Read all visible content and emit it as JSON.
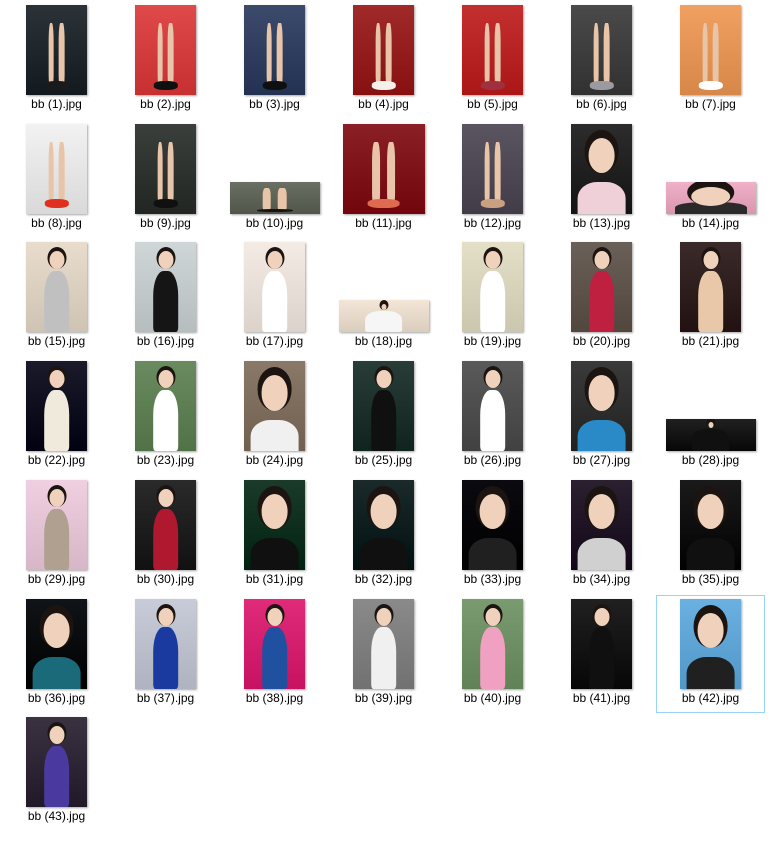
{
  "files": [
    {
      "name": "bb (1).jpg",
      "orientation": "portrait",
      "bg": "#2b3338",
      "subject": "legs",
      "accent": "#1a1a1a"
    },
    {
      "name": "bb (2).jpg",
      "orientation": "portrait",
      "bg": "#e0494a",
      "subject": "legs",
      "accent": "#101010"
    },
    {
      "name": "bb (3).jpg",
      "orientation": "portrait",
      "bg": "#3c4a6b",
      "subject": "legs",
      "accent": "#0f0f0f"
    },
    {
      "name": "bb (4).jpg",
      "orientation": "portrait",
      "bg": "#a02a2a",
      "subject": "legs",
      "accent": "#f5f0ea"
    },
    {
      "name": "bb (5).jpg",
      "orientation": "portrait",
      "bg": "#c42f2f",
      "subject": "legs",
      "accent": "#a03040"
    },
    {
      "name": "bb (6).jpg",
      "orientation": "portrait",
      "bg": "#4a4a4a",
      "subject": "legs",
      "accent": "#9a9aa0"
    },
    {
      "name": "bb (7).jpg",
      "orientation": "portrait",
      "bg": "#f0a060",
      "subject": "legs",
      "accent": "#ffffff"
    },
    {
      "name": "bb (8).jpg",
      "orientation": "portrait",
      "bg": "#f2f2f2",
      "subject": "legs",
      "accent": "#e03020"
    },
    {
      "name": "bb (9).jpg",
      "orientation": "portrait",
      "bg": "#3a3f3c",
      "subject": "legs",
      "accent": "#101010"
    },
    {
      "name": "bb (10).jpg",
      "orientation": "landscape",
      "bg": "#6a6f64",
      "subject": "legs",
      "accent": "#151515"
    },
    {
      "name": "bb (11).jpg",
      "orientation": "landscape-tall",
      "bg": "#8a1f25",
      "subject": "legs",
      "accent": "#e06a50"
    },
    {
      "name": "bb (12).jpg",
      "orientation": "portrait",
      "bg": "#5a5560",
      "subject": "legs",
      "accent": "#c9a080"
    },
    {
      "name": "bb (13).jpg",
      "orientation": "portrait",
      "bg": "#2c2c2c",
      "subject": "face",
      "accent": "#f0d0d8"
    },
    {
      "name": "bb (14).jpg",
      "orientation": "landscape",
      "bg": "#f0b0c8",
      "subject": "face",
      "accent": "#2a2a2a"
    },
    {
      "name": "bb (15).jpg",
      "orientation": "portrait",
      "bg": "#e8dccc",
      "subject": "figure",
      "accent": "#c0c0c0"
    },
    {
      "name": "bb (16).jpg",
      "orientation": "portrait",
      "bg": "#cfd6d8",
      "subject": "figure",
      "accent": "#151515"
    },
    {
      "name": "bb (17).jpg",
      "orientation": "portrait",
      "bg": "#f4ece4",
      "subject": "figure",
      "accent": "#ffffff"
    },
    {
      "name": "bb (18).jpg",
      "orientation": "landscape",
      "bg": "#f3e6d6",
      "subject": "figure",
      "accent": "#f6f6f6"
    },
    {
      "name": "bb (19).jpg",
      "orientation": "portrait",
      "bg": "#e4e0c8",
      "subject": "figure",
      "accent": "#ffffff"
    },
    {
      "name": "bb (20).jpg",
      "orientation": "portrait",
      "bg": "#6a6058",
      "subject": "figure",
      "accent": "#c02040"
    },
    {
      "name": "bb (21).jpg",
      "orientation": "portrait",
      "bg": "#3a2a2a",
      "subject": "figure",
      "accent": "#e8c8a8"
    },
    {
      "name": "bb (22).jpg",
      "orientation": "portrait",
      "bg": "#1a1a2a",
      "subject": "figure",
      "accent": "#f0eadc"
    },
    {
      "name": "bb (23).jpg",
      "orientation": "portrait",
      "bg": "#6a8a60",
      "subject": "figure",
      "accent": "#ffffff"
    },
    {
      "name": "bb (24).jpg",
      "orientation": "portrait",
      "bg": "#8a7868",
      "subject": "face",
      "accent": "#f0f0f0"
    },
    {
      "name": "bb (25).jpg",
      "orientation": "portrait",
      "bg": "#283c38",
      "subject": "figure",
      "accent": "#101010"
    },
    {
      "name": "bb (26).jpg",
      "orientation": "portrait",
      "bg": "#5a5a5a",
      "subject": "figure",
      "accent": "#ffffff"
    },
    {
      "name": "bb (27).jpg",
      "orientation": "portrait",
      "bg": "#3a3a3a",
      "subject": "face",
      "accent": "#2a8ac8"
    },
    {
      "name": "bb (28).jpg",
      "orientation": "landscape",
      "bg": "#202020",
      "subject": "figure",
      "accent": "#101010"
    },
    {
      "name": "bb (29).jpg",
      "orientation": "portrait",
      "bg": "#f0d0e0",
      "subject": "figure",
      "accent": "#b0a090"
    },
    {
      "name": "bb (30).jpg",
      "orientation": "portrait",
      "bg": "#2a2a2a",
      "subject": "figure",
      "accent": "#b01830"
    },
    {
      "name": "bb (31).jpg",
      "orientation": "portrait",
      "bg": "#1a3a2a",
      "subject": "face",
      "accent": "#101010"
    },
    {
      "name": "bb (32).jpg",
      "orientation": "portrait",
      "bg": "#1a2a2a",
      "subject": "face",
      "accent": "#101010"
    },
    {
      "name": "bb (33).jpg",
      "orientation": "portrait",
      "bg": "#0a0a10",
      "subject": "face",
      "accent": "#202020"
    },
    {
      "name": "bb (34).jpg",
      "orientation": "portrait",
      "bg": "#2a2030",
      "subject": "face",
      "accent": "#d0d0d0"
    },
    {
      "name": "bb (35).jpg",
      "orientation": "portrait",
      "bg": "#1a1a1a",
      "subject": "face",
      "accent": "#101010"
    },
    {
      "name": "bb (36).jpg",
      "orientation": "portrait",
      "bg": "#101418",
      "subject": "face",
      "accent": "#1a6a7a"
    },
    {
      "name": "bb (37).jpg",
      "orientation": "portrait",
      "bg": "#c8ccd8",
      "subject": "figure",
      "accent": "#1a3aa0"
    },
    {
      "name": "bb (38).jpg",
      "orientation": "portrait",
      "bg": "#e02a7a",
      "subject": "figure",
      "accent": "#2050a0"
    },
    {
      "name": "bb (39).jpg",
      "orientation": "portrait",
      "bg": "#8a8a8a",
      "subject": "figure",
      "accent": "#f0f0f0"
    },
    {
      "name": "bb (40).jpg",
      "orientation": "portrait",
      "bg": "#7a9a70",
      "subject": "figure",
      "accent": "#f0a0c0"
    },
    {
      "name": "bb (41).jpg",
      "orientation": "portrait",
      "bg": "#202020",
      "subject": "figure",
      "accent": "#101010"
    },
    {
      "name": "bb (42).jpg",
      "orientation": "portrait",
      "bg": "#6ab0e0",
      "subject": "face",
      "accent": "#202020",
      "selected": true
    },
    {
      "name": "bb (43).jpg",
      "orientation": "portrait",
      "bg": "#3a3240",
      "subject": "figure",
      "accent": "#4a3aa0"
    }
  ]
}
